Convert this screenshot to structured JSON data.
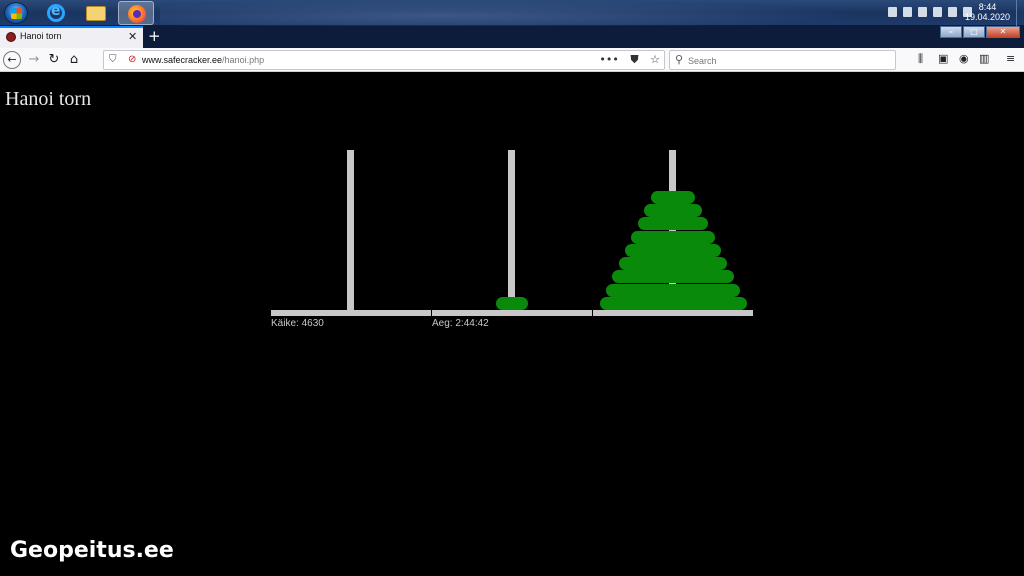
{
  "taskbar": {
    "apps": [
      {
        "name": "start",
        "active": false
      },
      {
        "name": "internet-explorer",
        "active": false
      },
      {
        "name": "file-explorer",
        "active": false
      },
      {
        "name": "firefox",
        "active": true
      }
    ],
    "clock": {
      "time": "8:44",
      "date": "19.04.2020"
    }
  },
  "browser": {
    "tab_title": "Hanoi torn",
    "url_host": "www.safecracker.ee",
    "url_path": "/hanoi.php",
    "search_placeholder": "Search",
    "icons": [
      "back-icon",
      "forward-icon",
      "reload-icon",
      "home-icon",
      "shield-icon",
      "lock-warning-icon",
      "page-actions-icon",
      "pocket-icon",
      "bookmark-star-icon",
      "search-icon",
      "library-icon",
      "sidebar-icon",
      "account-icon",
      "extensions-icon",
      "menu-icon"
    ]
  },
  "page": {
    "title": "Hanoi torn",
    "moves_label": "Käike: 4630",
    "time_label": "Aeg: 2:44:42"
  },
  "game": {
    "disk_color": "#0a8a0a",
    "peg_color": "#c8c8c8",
    "pegs": [
      {
        "disks": []
      },
      {
        "disks": [
          1
        ]
      },
      {
        "disks": [
          10,
          9,
          8,
          7,
          6,
          5,
          4,
          3,
          2
        ]
      }
    ]
  },
  "watermark": "Geopeitus.ee"
}
